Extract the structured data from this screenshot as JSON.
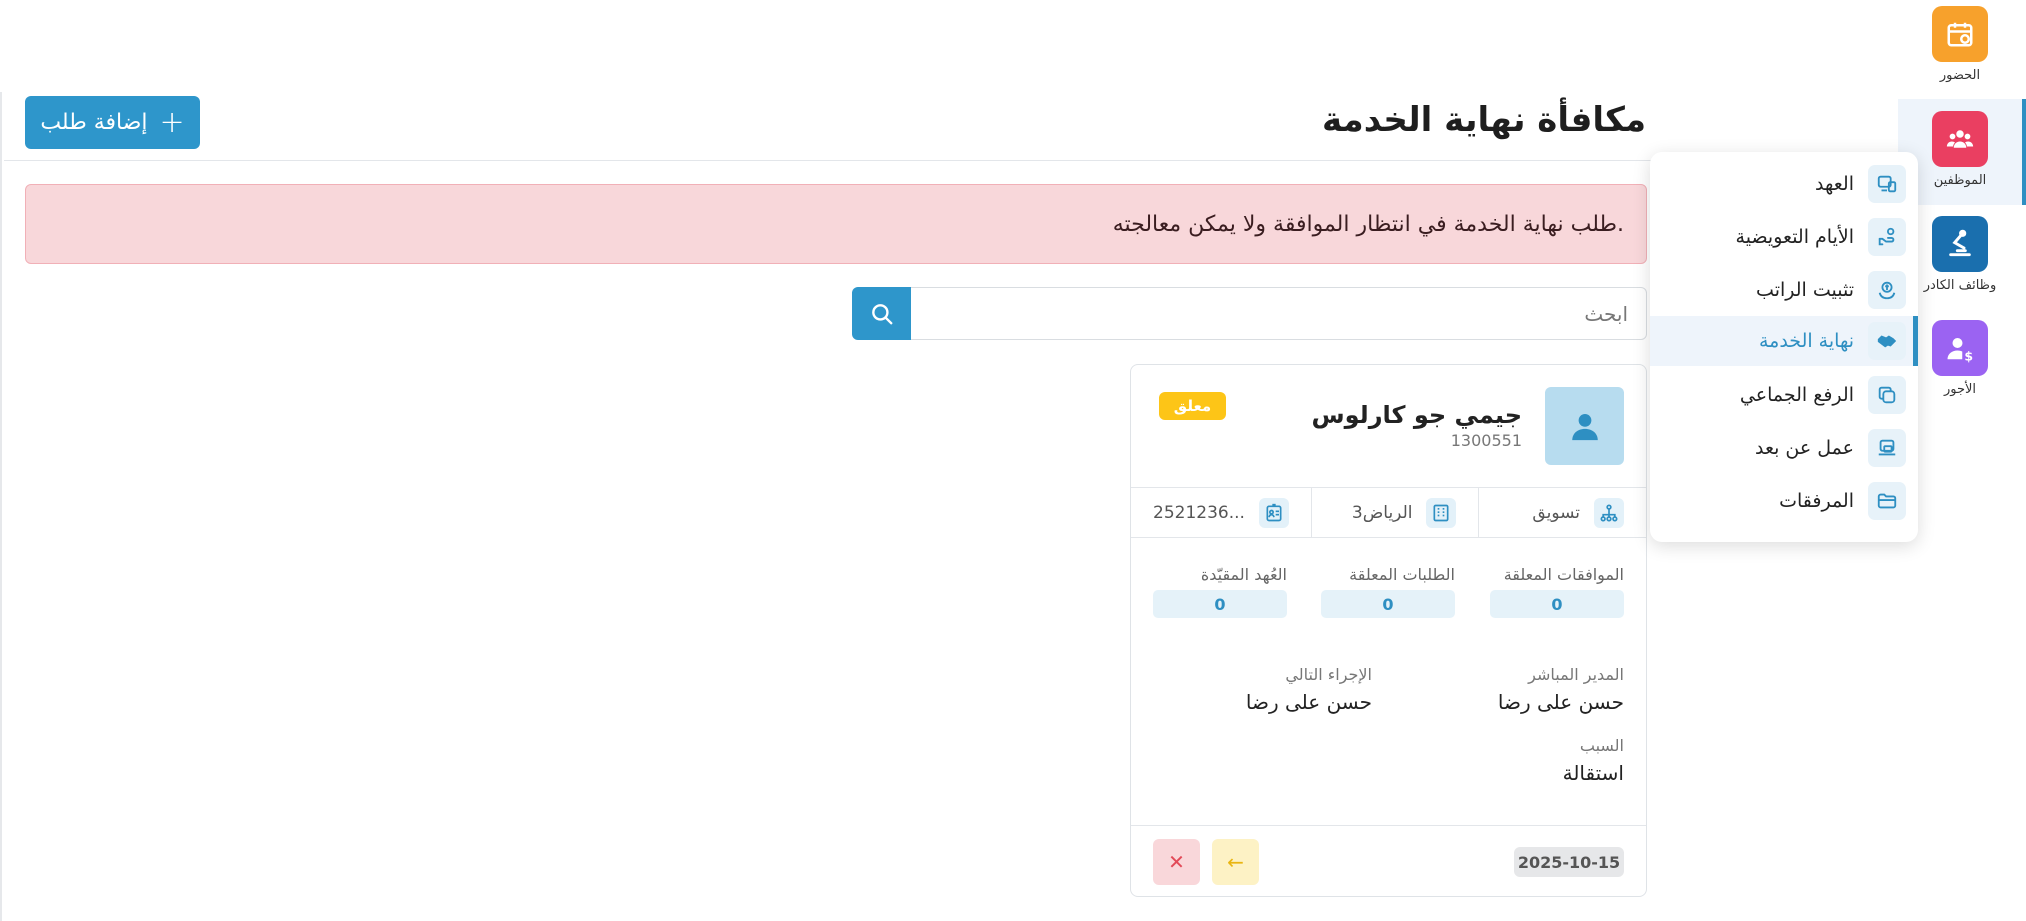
{
  "rail": [
    {
      "label": "الحضور",
      "icon": "calendar-icon",
      "color": "#f7a12c"
    },
    {
      "label": "الموظفين",
      "icon": "users-icon",
      "color": "#ea3f61"
    },
    {
      "label": "وظائف الكادر",
      "icon": "robot-arm-icon",
      "color": "#1a6fae"
    },
    {
      "label": "الأجور",
      "icon": "user-dollar-icon",
      "color": "#9b63f2"
    }
  ],
  "header": {
    "title": "مكافأة نهاية الخدمة",
    "add_label": "إضافة طلب"
  },
  "alert": {
    "text": "طلب نهاية الخدمة في انتظار الموافقة ولا يمكن معالجته."
  },
  "search": {
    "placeholder": "ابحث"
  },
  "card": {
    "name": "جيمي جو كارلوس",
    "id": "1300551",
    "status": "معلق",
    "department": "تسويق",
    "location": "الرياض3",
    "id_number": "2521236...",
    "stats": {
      "pending_approvals_label": "الموافقات المعلقة",
      "pending_approvals_value": "0",
      "pending_requests_label": "الطلبات المعلقة",
      "pending_requests_value": "0",
      "bound_custody_label": "العُهد المقيّدة",
      "bound_custody_value": "0"
    },
    "manager_label": "المدير المباشر",
    "manager_value": "حسن على رضا",
    "next_action_label": "الإجراء التالي",
    "next_action_value": "حسن على رضا",
    "reason_label": "السبب",
    "reason_value": "استقالة",
    "date": "2025-10-15"
  },
  "submenu": {
    "items": [
      {
        "label": "العهد",
        "icon": "custody-icon"
      },
      {
        "label": "الأيام التعويضية",
        "icon": "hand-icon"
      },
      {
        "label": "تثبيت الراتب",
        "icon": "salary-icon"
      },
      {
        "label": "نهاية الخدمة",
        "icon": "handshake-icon",
        "active": true
      },
      {
        "label": "الرفع الجماعي",
        "icon": "copy-icon"
      },
      {
        "label": "عمل عن بعد",
        "icon": "laptop-icon"
      },
      {
        "label": "المرفقات",
        "icon": "folder-icon"
      }
    ]
  },
  "colors": {
    "primary": "#2e96cb",
    "alert_bg": "#f8d7da",
    "status_pending": "#fdc517",
    "danger_soft": "#f9d7da",
    "warning_soft": "#fdf2c5"
  }
}
